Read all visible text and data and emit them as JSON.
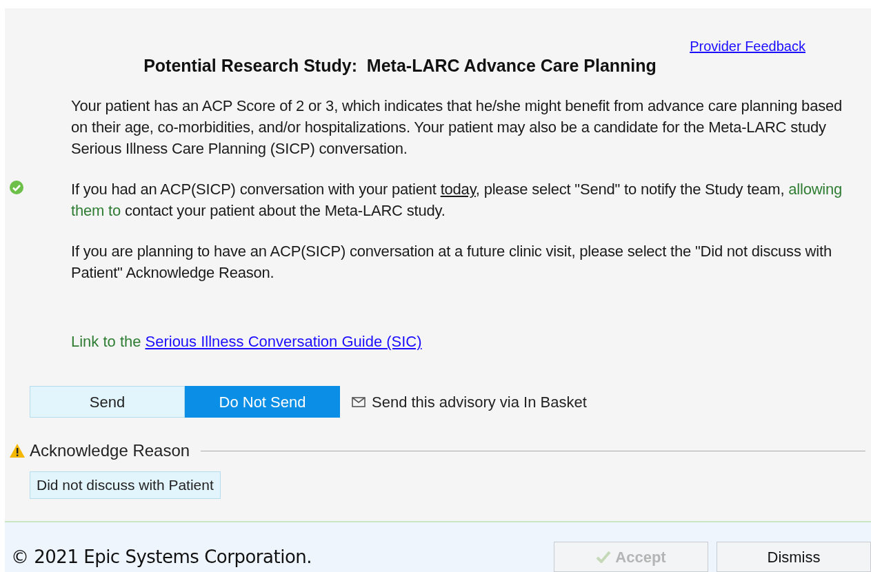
{
  "header": {
    "feedback_link": "Provider Feedback",
    "title": "Potential Research Study:  Meta-LARC Advance Care Planning"
  },
  "paragraphs": [
    {
      "checked": false,
      "segments": [
        {
          "kind": "plain",
          "text": "Your patient has an ACP Score of 2 or 3, which indicates that he/she might benefit from advance care planning based on their age, co-morbidities, and/or hospitalizations.  Your patient may also be a candidate for the Meta-LARC study Serious Illness Care Planning (SICP) conversation."
        }
      ]
    },
    {
      "checked": true,
      "segments": [
        {
          "kind": "plain",
          "text": "If you had an ACP(SICP) conversation with your patient "
        },
        {
          "kind": "underline",
          "text": "today"
        },
        {
          "kind": "plain",
          "text": ", please select \"Send\" to notify the Study team, "
        },
        {
          "kind": "green",
          "text": "allowing them to"
        },
        {
          "kind": "plain",
          "text": " contact your patient about the Meta-LARC study."
        }
      ]
    },
    {
      "checked": false,
      "segments": [
        {
          "kind": "plain",
          "text": "If you are planning to have an ACP(SICP) conversation at a future clinic visit, please select the \"Did not discuss with Patient\" Acknowledge Reason."
        }
      ]
    }
  ],
  "guide": {
    "prefix": "Link to the",
    "link": "Serious Illness Conversation Guide (SIC)"
  },
  "actions": [
    {
      "label": "Send",
      "selected": false
    },
    {
      "label": "Do Not Send",
      "selected": true
    }
  ],
  "in_basket": "Send this advisory via In Basket",
  "acknowledge": {
    "title": "Acknowledge Reason",
    "reasons": [
      {
        "label": "Did not discuss with Patient",
        "selected": false
      }
    ]
  },
  "footer": {
    "copyright": "© 2021 Epic Systems Corporation.",
    "buttons": [
      {
        "label": "Accept",
        "disabled": true
      },
      {
        "label": "Dismiss",
        "disabled": false
      }
    ]
  }
}
